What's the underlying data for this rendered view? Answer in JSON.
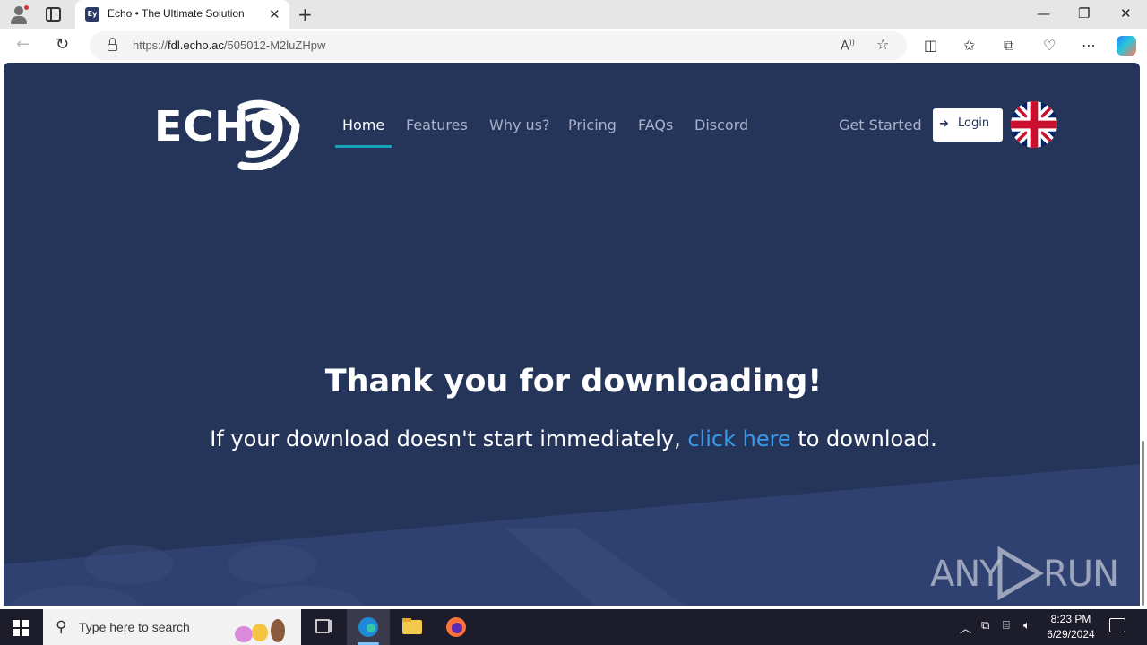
{
  "browser": {
    "tab_title": "Echo • The Ultimate Solution",
    "tab_favicon_text": "Ey",
    "url_prefix": "https://",
    "url_domain": "fdl.echo.ac",
    "url_path": "/505012-M2luZHpw"
  },
  "site": {
    "logo_text": "ECHO",
    "nav": [
      {
        "label": "Home",
        "active": true
      },
      {
        "label": "Features"
      },
      {
        "label": "Why us?"
      },
      {
        "label": "Pricing"
      },
      {
        "label": "FAQs"
      },
      {
        "label": "Discord"
      }
    ],
    "get_started": "Get Started",
    "login_label": "Login",
    "language_icon": "uk-flag-icon"
  },
  "content": {
    "headline": "Thank you for downloading!",
    "sub_before": "If your download doesn't start immediately, ",
    "sub_link": "click here",
    "sub_after": " to download."
  },
  "watermark": {
    "left": "ANY",
    "right": "RUN"
  },
  "taskbar": {
    "search_placeholder": "Type here to search",
    "time": "8:23 PM",
    "date": "6/29/2024"
  },
  "colors": {
    "page_bg": "#253459",
    "wave_bg": "#2f4170",
    "accent_underline": "#17a2b8",
    "link": "#3b9ae8"
  }
}
